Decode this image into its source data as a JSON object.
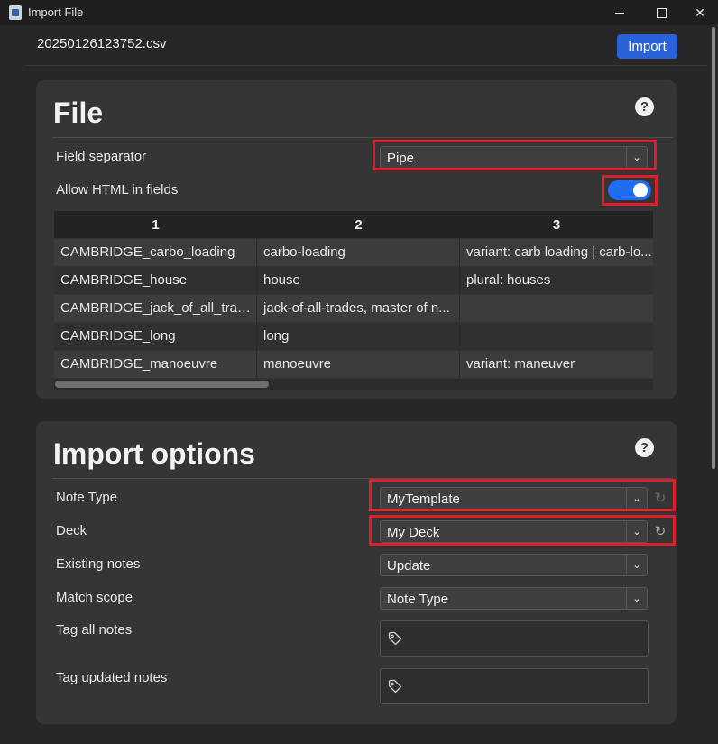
{
  "window": {
    "title": "Import File",
    "minimize_glyph": "—",
    "close_glyph": "✕"
  },
  "header": {
    "file_name": "20250126123752.csv",
    "import_label": "Import"
  },
  "file_section": {
    "title": "File",
    "help_glyph": "?",
    "field_separator": {
      "label": "Field separator",
      "value": "Pipe"
    },
    "allow_html": {
      "label": "Allow HTML in fields",
      "enabled": true
    },
    "table": {
      "headers": [
        "1",
        "2",
        "3"
      ],
      "rows": [
        [
          "CAMBRIDGE_carbo_loading",
          "carbo-loading",
          "variant: carb loading | carb-lo..."
        ],
        [
          "CAMBRIDGE_house",
          "house",
          "plural: houses"
        ],
        [
          "CAMBRIDGE_jack_of_all_trade...",
          "jack-of-all-trades, master of n...",
          ""
        ],
        [
          "CAMBRIDGE_long",
          "long",
          ""
        ],
        [
          "CAMBRIDGE_manoeuvre",
          "manoeuvre",
          "variant: maneuver"
        ]
      ]
    }
  },
  "import_options": {
    "title": "Import options",
    "help_glyph": "?",
    "note_type": {
      "label": "Note Type",
      "value": "MyTemplate"
    },
    "deck": {
      "label": "Deck",
      "value": "My Deck"
    },
    "existing_notes": {
      "label": "Existing notes",
      "value": "Update"
    },
    "match_scope": {
      "label": "Match scope",
      "value": "Note Type"
    },
    "tag_all": {
      "label": "Tag all notes",
      "value": ""
    },
    "tag_updated": {
      "label": "Tag updated notes",
      "value": ""
    }
  },
  "colors": {
    "accent": "#2a63d8",
    "toggle_on": "#1f6ef2",
    "highlight": "#e01e2a",
    "background": "#272727",
    "card": "#353535"
  },
  "icons": {
    "dropdown": "chevron-down-icon",
    "revert": "revert-icon",
    "tag": "tag-icon",
    "help": "help-icon"
  }
}
